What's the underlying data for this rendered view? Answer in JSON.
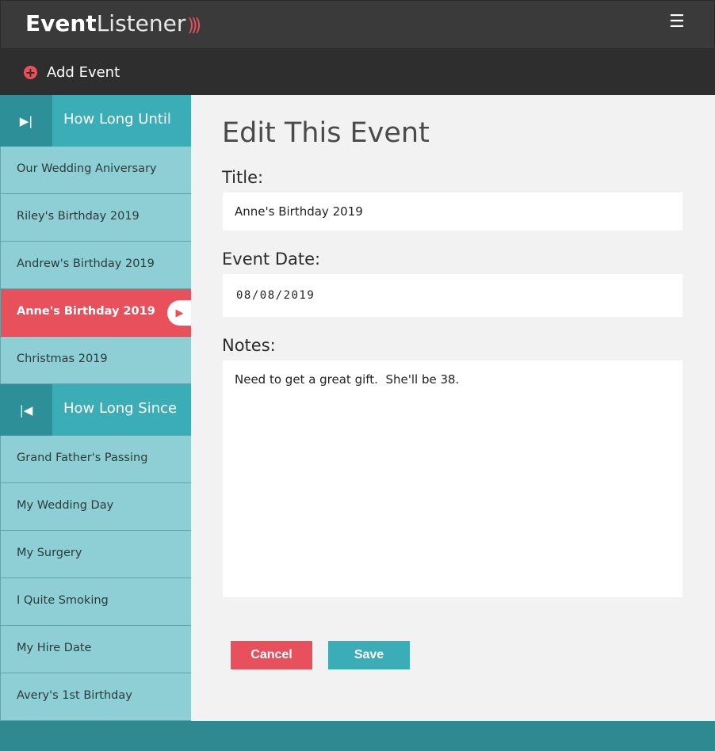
{
  "header": {
    "logo_bold": "Event",
    "logo_light": "Listener",
    "logo_waves": ")))",
    "menu_icon": "☰"
  },
  "toolbar": {
    "add_icon": "+",
    "add_label": "Add Event"
  },
  "sidebar": {
    "until": {
      "icon": "▶|",
      "label": "How Long Until",
      "items": [
        {
          "label": "Our Wedding Aniversary"
        },
        {
          "label": "Riley's Birthday 2019"
        },
        {
          "label": "Andrew's Birthday 2019"
        },
        {
          "label": "Anne's Birthday 2019",
          "active": true
        },
        {
          "label": "Christmas 2019"
        }
      ]
    },
    "since": {
      "icon": "|◀",
      "label": "How Long Since",
      "items": [
        {
          "label": "Grand Father's Passing"
        },
        {
          "label": "My Wedding Day"
        },
        {
          "label": "My Surgery"
        },
        {
          "label": "I Quite Smoking"
        },
        {
          "label": "My Hire Date"
        },
        {
          "label": "Avery's 1st Birthday"
        }
      ]
    },
    "active_arrow": "▶"
  },
  "form": {
    "heading": "Edit This Event",
    "title_label": "Title:",
    "title_value": "Anne's Birthday 2019",
    "date_label": "Event Date:",
    "date_value": "08/08/2019",
    "notes_label": "Notes:",
    "notes_value": "Need to get a great gift.  She'll be 38.",
    "cancel_label": "Cancel",
    "save_label": "Save"
  },
  "colors": {
    "accent": "#e8505b",
    "teal": "#3aadb7",
    "sidebar_bg": "#8dcfd4",
    "topbar": "#3a3a3a"
  }
}
